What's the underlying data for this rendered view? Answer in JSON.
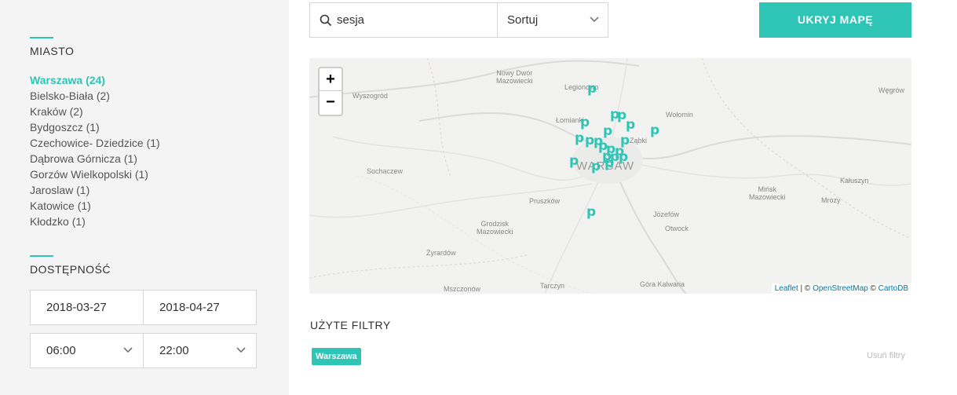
{
  "sidebar": {
    "city_section_title": "MIASTO",
    "cities": [
      {
        "label": "Warszawa (24)",
        "active": true
      },
      {
        "label": "Bielsko-Biała (2)"
      },
      {
        "label": "Kraków (2)"
      },
      {
        "label": "Bydgoszcz (1)"
      },
      {
        "label": "Czechowice- Dziedzice (1)"
      },
      {
        "label": "Dąbrowa Górnicza (1)"
      },
      {
        "label": "Gorzów Wielkopolski (1)"
      },
      {
        "label": "Jaroslaw (1)"
      },
      {
        "label": "Katowice (1)"
      },
      {
        "label": "Kłodzko (1)"
      }
    ],
    "availability_section_title": "DOSTĘPNOŚĆ",
    "date_from": "2018-03-27",
    "date_to": "2018-04-27",
    "time_from": "06:00",
    "time_to": "22:00"
  },
  "search": {
    "value": "sesja",
    "placeholder": ""
  },
  "sort": {
    "label": "Sortuj"
  },
  "hide_map_button": "UKRYJ MAPĘ",
  "map": {
    "zoom_in": "+",
    "zoom_out": "−",
    "labels": {
      "nowy_dwor": "Nowy Dwór\nMazowiecki",
      "legionowo": "Legionowo",
      "wyszogrod": "Wyszogród",
      "wegrow": "Węgrów",
      "lomianki": "Łomianki",
      "wolomin": "Wołomin",
      "zabki": "Ząbki",
      "sochaczew": "Sochaczew",
      "warsaw": "WARSAW",
      "minsk": "Mińsk\nMazowiecki",
      "kaluszyn": "Kałuszyn",
      "mrozy": "Mrozy",
      "pruszkow": "Pruszków",
      "jozefow": "Józefów",
      "grodzisk": "Grodzisk\nMazowiecki",
      "otwock": "Otwock",
      "zyrardow": "Żyrardów",
      "mszczonow": "Mszczonów",
      "tarczyn": "Tarczyn",
      "gora_kalwaria": "Góra Kalwaria"
    },
    "marker_glyph": "p",
    "attribution": {
      "leaflet": "Leaflet",
      "sep1": " | © ",
      "osm": "OpenStreetMap",
      "sep2": " © ",
      "carto": "CartoDB"
    }
  },
  "filters": {
    "title": "UŻYTE FILTRY",
    "tags": [
      "Warszawa"
    ],
    "clear_label": "Usuń filtry"
  },
  "colors": {
    "accent": "#2ec4b6"
  }
}
